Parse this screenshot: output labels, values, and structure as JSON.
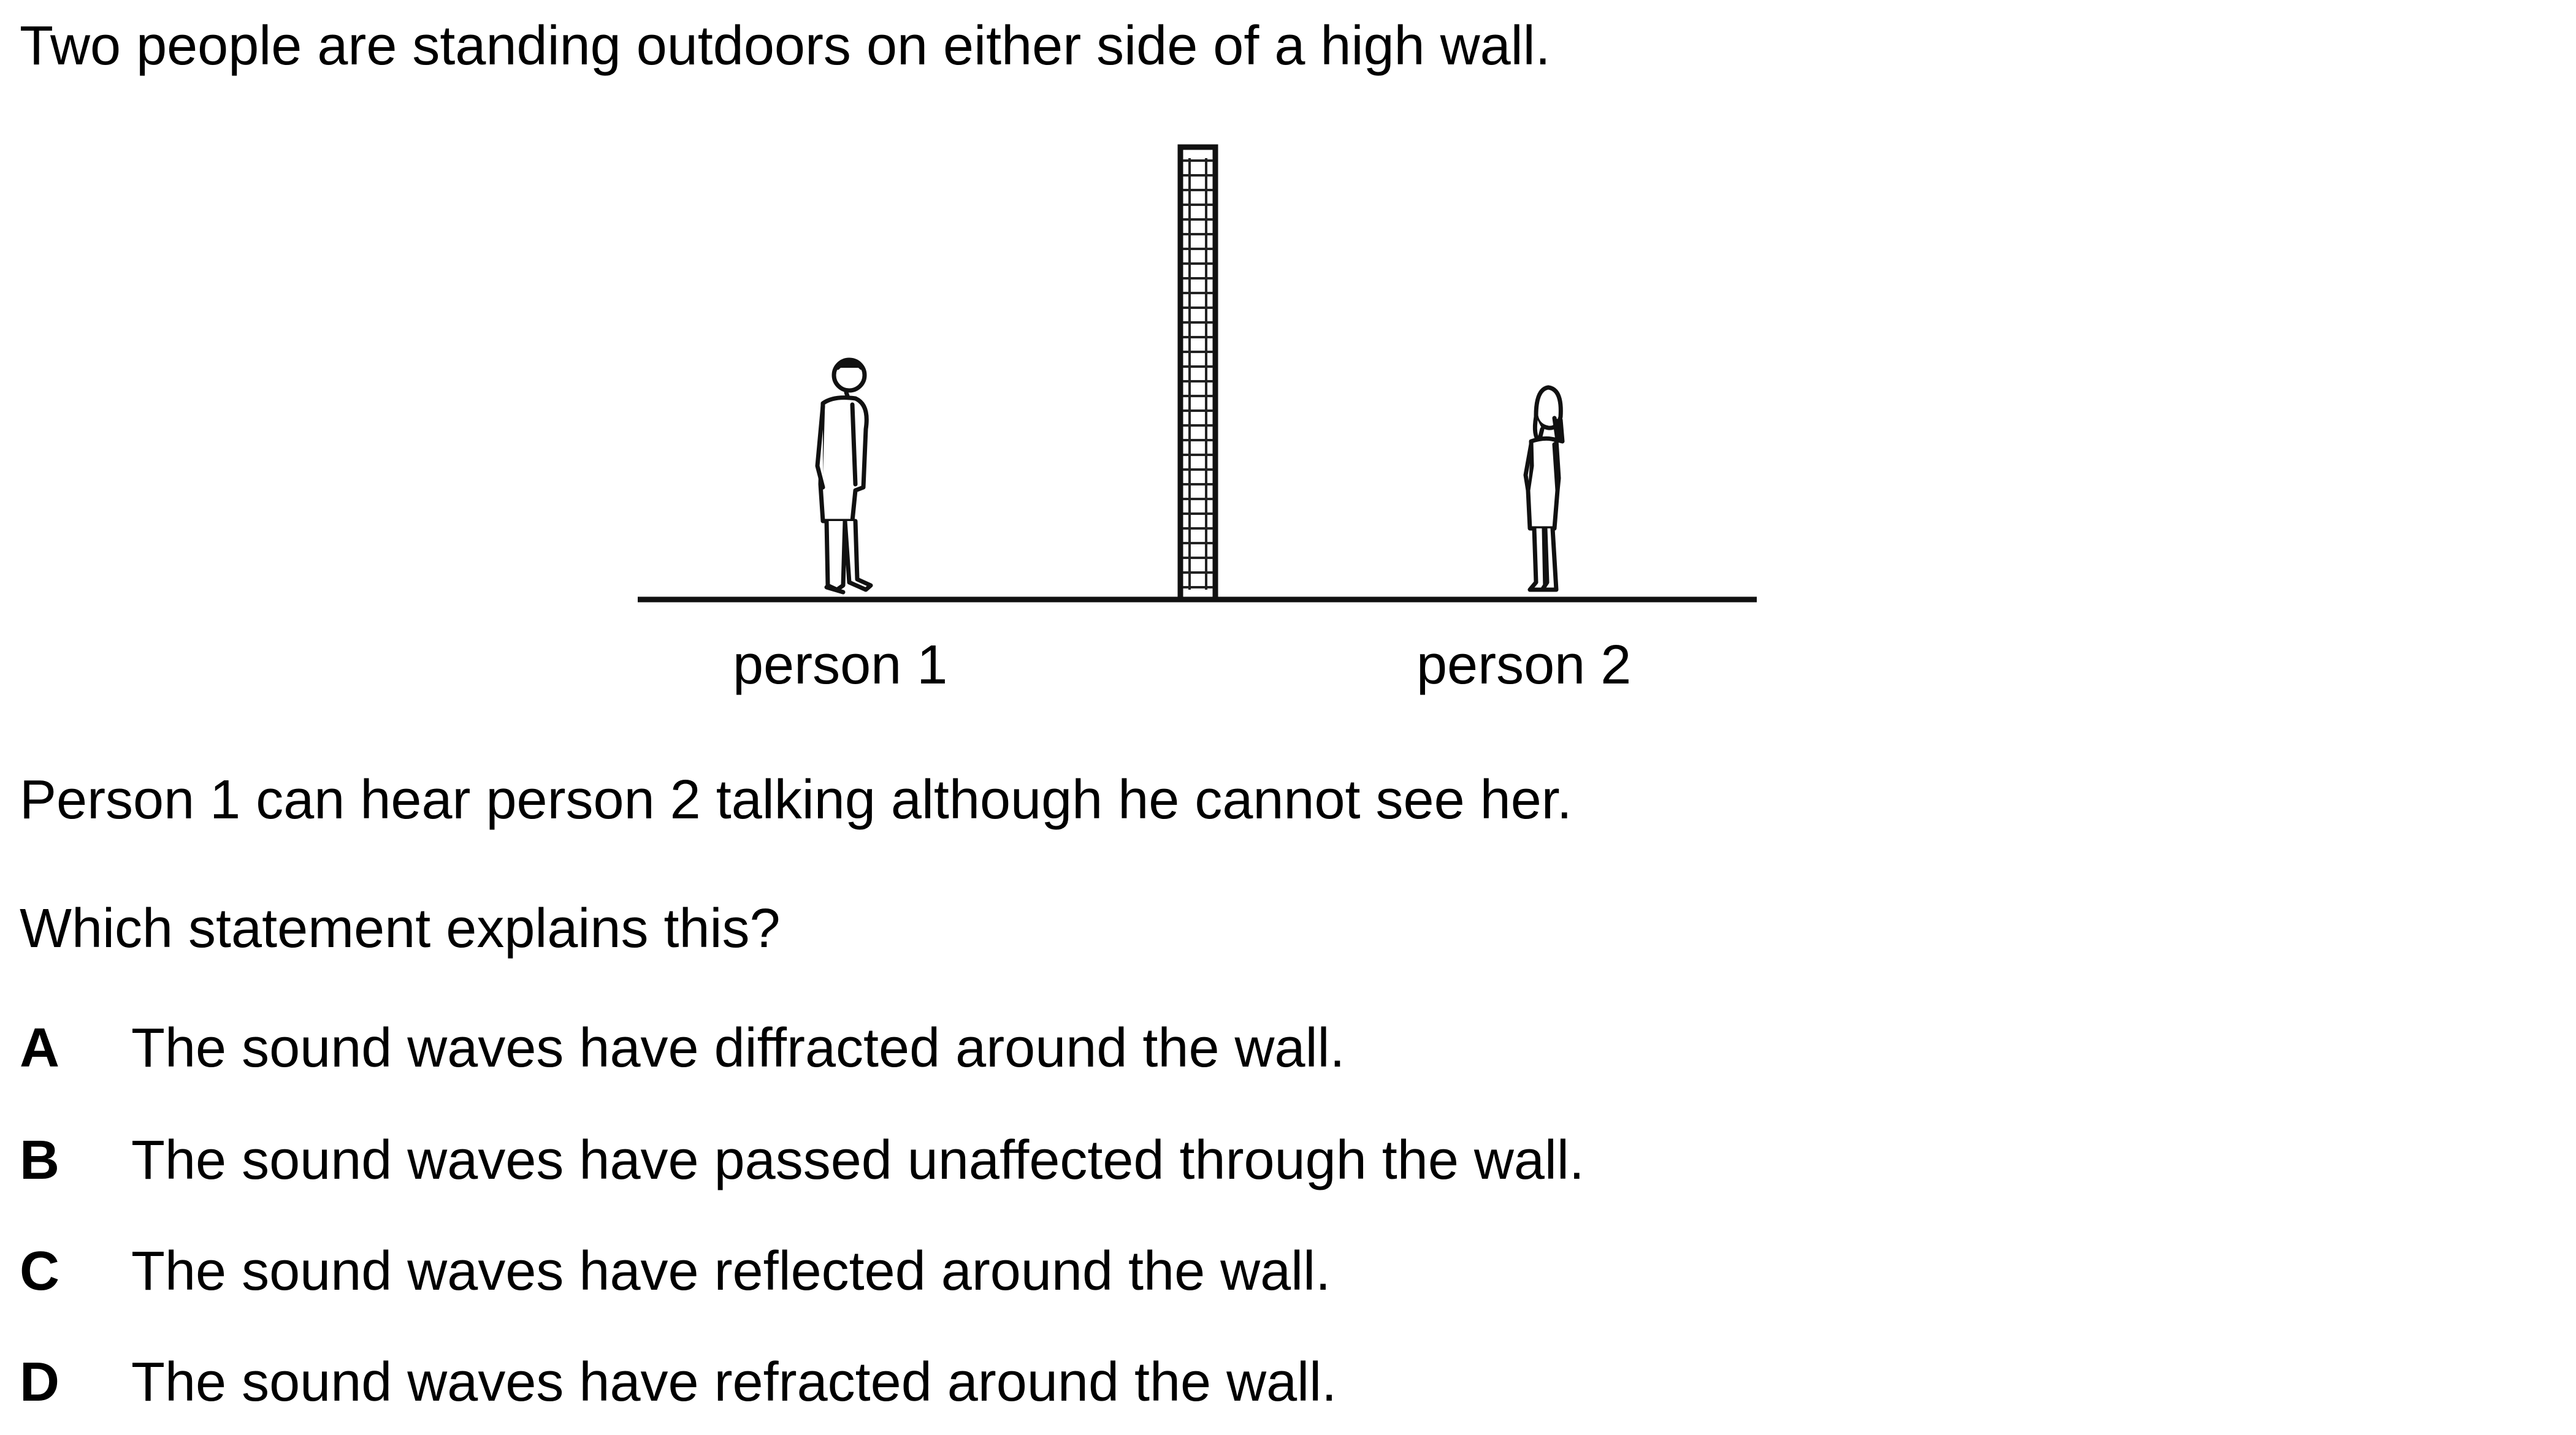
{
  "question": {
    "intro": "Two people are standing outdoors on either side of a high wall.",
    "observation": "Person 1 can hear person 2 talking although he cannot see her.",
    "prompt": "Which statement explains this?"
  },
  "diagram": {
    "person1_label": "person 1",
    "person2_label": "person 2"
  },
  "options": [
    {
      "letter": "A",
      "text": "The sound waves have diffracted around the wall."
    },
    {
      "letter": "B",
      "text": "The sound waves have passed unaffected through the wall."
    },
    {
      "letter": "C",
      "text": "The sound waves have reflected around the wall."
    },
    {
      "letter": "D",
      "text": "The sound waves have refracted around the wall."
    }
  ]
}
